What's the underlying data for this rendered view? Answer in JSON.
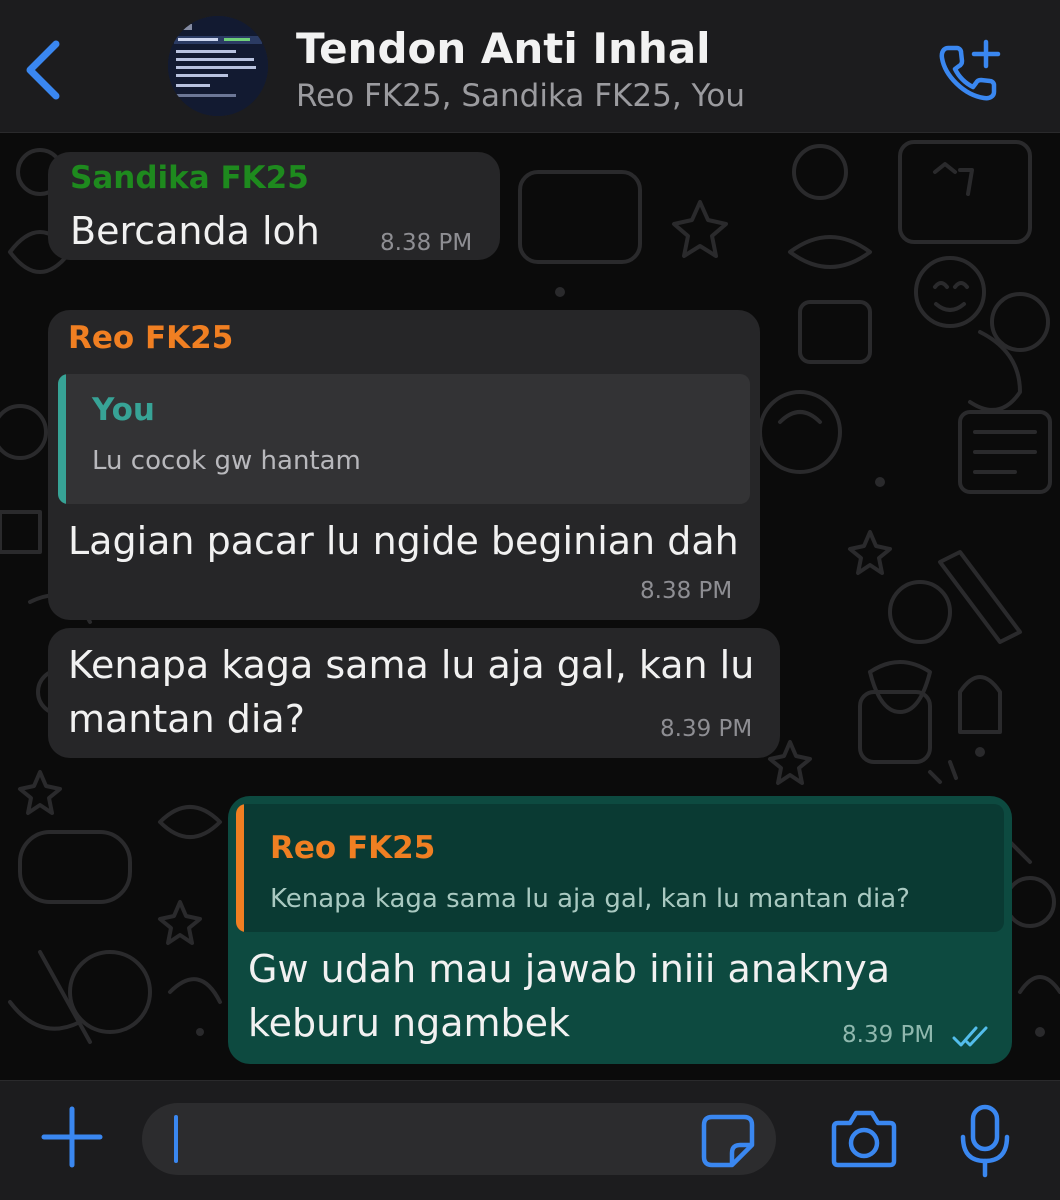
{
  "header": {
    "back_icon": "chevron-left-icon",
    "avatar_icon": "group-avatar-image",
    "title": "Tendon Anti Inhal",
    "subtitle": "Reo FK25, Sandika FK25, You",
    "call_icon": "add-call-icon"
  },
  "colors": {
    "accent": "#3a87f0",
    "incoming_bubble": "#262628",
    "outgoing_bubble": "#0d4a40",
    "sender_sandika": "#1e8a1e",
    "sender_reo": "#f07f22",
    "quote_you": "#37a396",
    "read_ticks": "#53bdeb"
  },
  "messages": [
    {
      "direction": "incoming",
      "sender": "Sandika FK25",
      "text": "Bercanda loh",
      "time": "8.38 PM"
    },
    {
      "direction": "incoming",
      "sender": "Reo FK25",
      "quote": {
        "sender": "You",
        "text": "Lu cocok gw hantam"
      },
      "text": "Lagian pacar lu ngide beginian dah",
      "time": "8.38 PM"
    },
    {
      "direction": "incoming",
      "text_lines": [
        "Kenapa kaga sama lu aja gal, kan lu",
        "mantan dia?"
      ],
      "time": "8.39 PM"
    },
    {
      "direction": "outgoing",
      "quote": {
        "sender": "Reo FK25",
        "text": "Kenapa kaga sama lu aja gal, kan lu mantan dia?"
      },
      "text_lines": [
        "Gw udah mau jawab iniii anaknya",
        "keburu ngambek"
      ],
      "time": "8.39 PM",
      "status_icon": "double-check-read-icon"
    }
  ],
  "input": {
    "value": "",
    "plus_icon": "plus-icon",
    "sticker_icon": "sticker-icon",
    "camera_icon": "camera-icon",
    "mic_icon": "microphone-icon"
  }
}
